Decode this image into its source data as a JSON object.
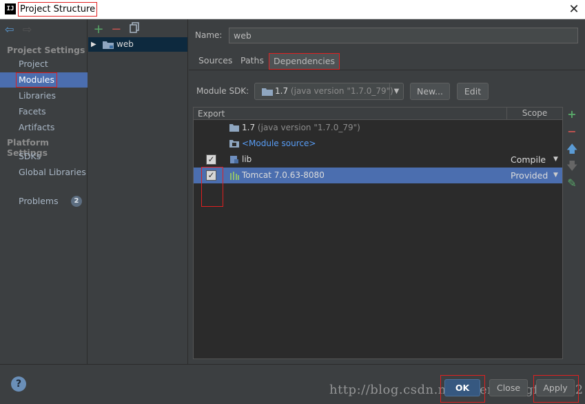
{
  "window": {
    "title": "Project Structure",
    "app_icon": "IJ"
  },
  "sidebar": {
    "sections": [
      {
        "title": "Project Settings",
        "items": [
          "Project",
          "Modules",
          "Libraries",
          "Facets",
          "Artifacts"
        ]
      },
      {
        "title": "Platform Settings",
        "items": [
          "SDKs",
          "Global Libraries"
        ]
      }
    ],
    "problems": {
      "label": "Problems",
      "count": "2"
    },
    "selected": "Modules"
  },
  "module_tree": {
    "items": [
      "web"
    ]
  },
  "module": {
    "name_label": "Name:",
    "name_value": "web",
    "tabs": [
      "Sources",
      "Paths",
      "Dependencies"
    ],
    "active_tab": "Dependencies",
    "sdk_label": "Module SDK:",
    "sdk_version": "1.7",
    "sdk_detail": "(java version \"1.7.0_79\")",
    "new_button": "New...",
    "edit_button": "Edit"
  },
  "dependencies": {
    "headers": {
      "export": "Export",
      "scope": "Scope"
    },
    "rows": [
      {
        "name": "1.7",
        "detail": "(java version \"1.7.0_79\")",
        "checked": null,
        "scope": ""
      },
      {
        "name": "<Module source>",
        "detail": "",
        "checked": null,
        "scope": ""
      },
      {
        "name": "lib",
        "detail": "",
        "checked": true,
        "scope": "Compile"
      },
      {
        "name": "Tomcat 7.0.63-8080",
        "detail": "",
        "checked": true,
        "scope": "Provided"
      }
    ]
  },
  "footer": {
    "ok": "OK",
    "close": "Close",
    "apply": "Apply",
    "watermark": "http://blog.csdn.net/chengtengfei1862"
  },
  "colors": {
    "accent": "#4b6eaf",
    "highlight": "#e02020",
    "background": "#3c3f41"
  }
}
